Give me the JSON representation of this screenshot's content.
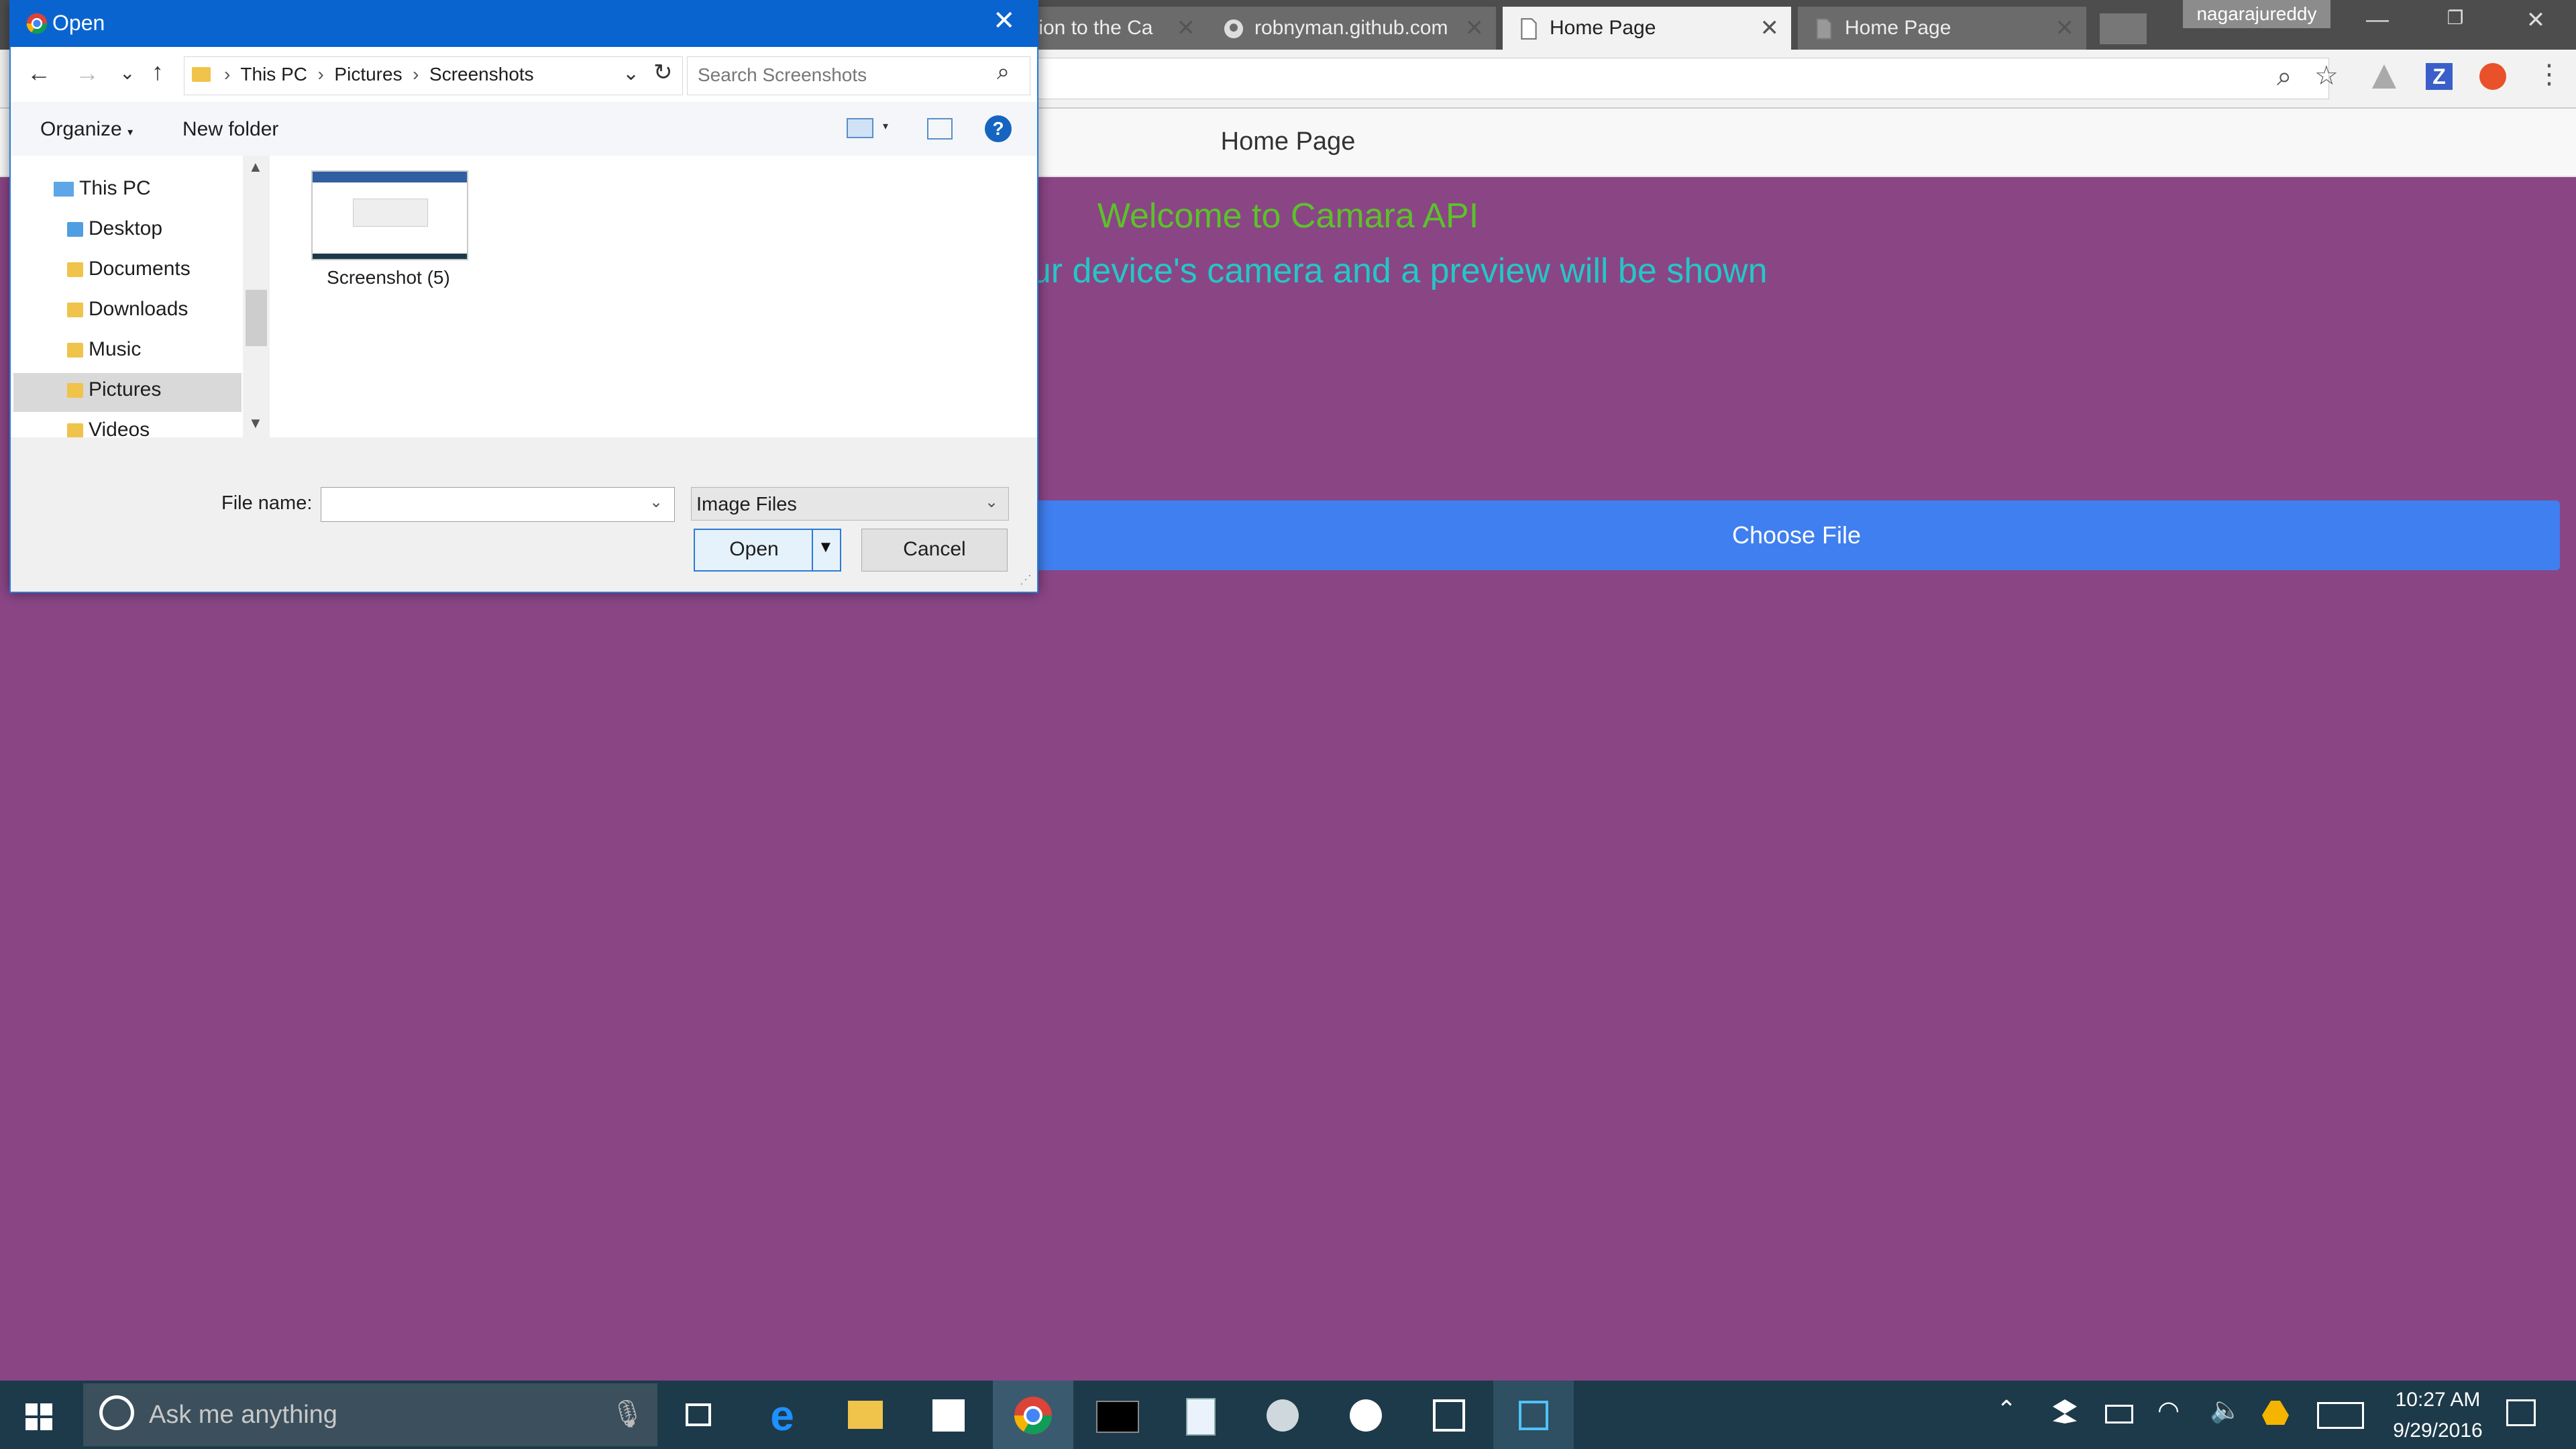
{
  "browser": {
    "tabs": [
      {
        "label": "tion to the Ca",
        "active": false
      },
      {
        "label": "robnyman.github.com",
        "active": false
      },
      {
        "label": "Home Page",
        "active": true
      },
      {
        "label": "Home Page",
        "active": false
      }
    ],
    "profile": "nagarajureddy"
  },
  "page": {
    "header_title": "Home Page",
    "welcome": "Welcome to Camara API",
    "instructions": "picture with your device's camera and a preview will be shown",
    "choose_file": "Choose File",
    "colors": {
      "background": "#8a4585",
      "welcome": "#5cc22a",
      "instructions": "#24c7c7",
      "button": "#3f7fef"
    }
  },
  "dialog": {
    "title": "Open",
    "breadcrumb": [
      "This PC",
      "Pictures",
      "Screenshots"
    ],
    "search_placeholder": "Search Screenshots",
    "organize": "Organize",
    "new_folder": "New folder",
    "nav": [
      "This PC",
      "Desktop",
      "Documents",
      "Downloads",
      "Music",
      "Pictures",
      "Videos"
    ],
    "selected_nav": "Pictures",
    "files": [
      {
        "name": "Screenshot (5)"
      }
    ],
    "filename_label": "File name:",
    "filename_value": "",
    "filetype": "Image Files",
    "open": "Open",
    "cancel": "Cancel"
  },
  "taskbar": {
    "search_placeholder": "Ask me anything",
    "time": "10:27 AM",
    "date": "9/29/2016"
  }
}
